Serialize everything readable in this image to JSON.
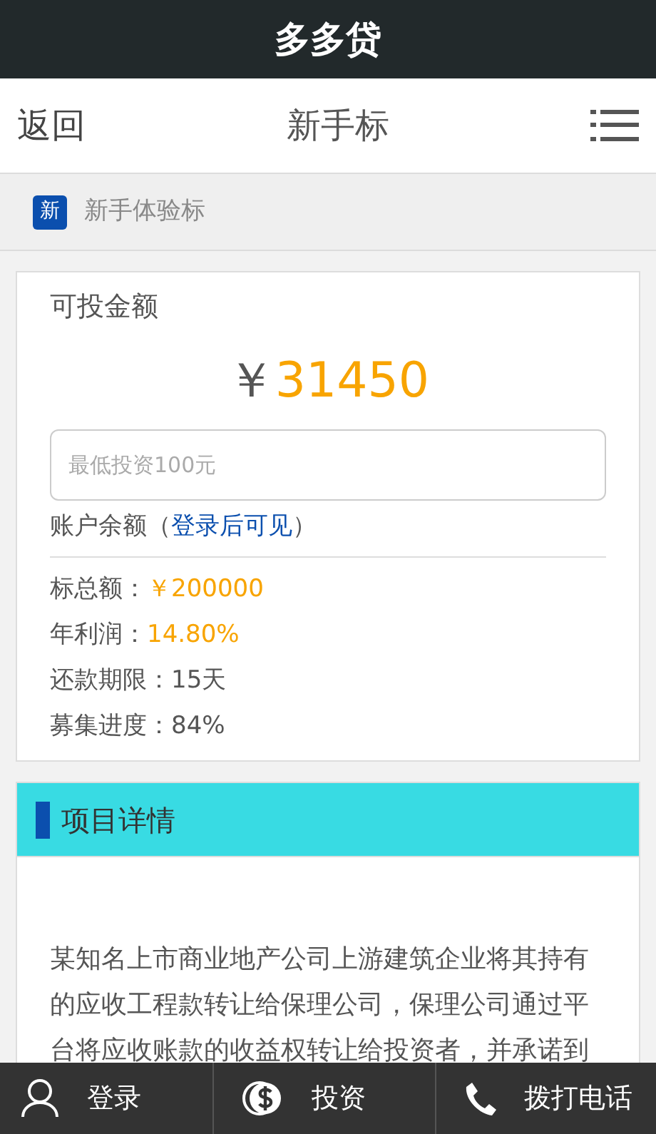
{
  "app_title": "多多贷",
  "header": {
    "back": "返回",
    "title": "新手标"
  },
  "category": {
    "badge": "新",
    "label": "新手体验标"
  },
  "invest_card": {
    "heading": "可投金额",
    "currency": "￥",
    "amount": "31450",
    "input_placeholder": "最低投资100元",
    "balance_label": "账户余额（",
    "balance_link": "登录后可见",
    "balance_close": "）",
    "facts": [
      {
        "label": "标总额：",
        "value": "￥200000",
        "highlight": true
      },
      {
        "label": "年利润：",
        "value": "14.80%",
        "highlight": true
      },
      {
        "label": "还款期限：",
        "value": "15天",
        "highlight": false
      },
      {
        "label": "募集进度：",
        "value": "84%",
        "highlight": false
      }
    ]
  },
  "details": {
    "heading": "项目详情",
    "text": "某知名上市商业地产公司上游建筑企业将其持有的应收工程款转让给保理公司，保理公司通过平台将应收账款的收益权转让给投资者，并承诺到"
  },
  "bottom_nav": [
    {
      "kind": "user",
      "label": "登录"
    },
    {
      "kind": "money",
      "label": "投资"
    },
    {
      "kind": "phone",
      "label": "拨打电话"
    }
  ]
}
